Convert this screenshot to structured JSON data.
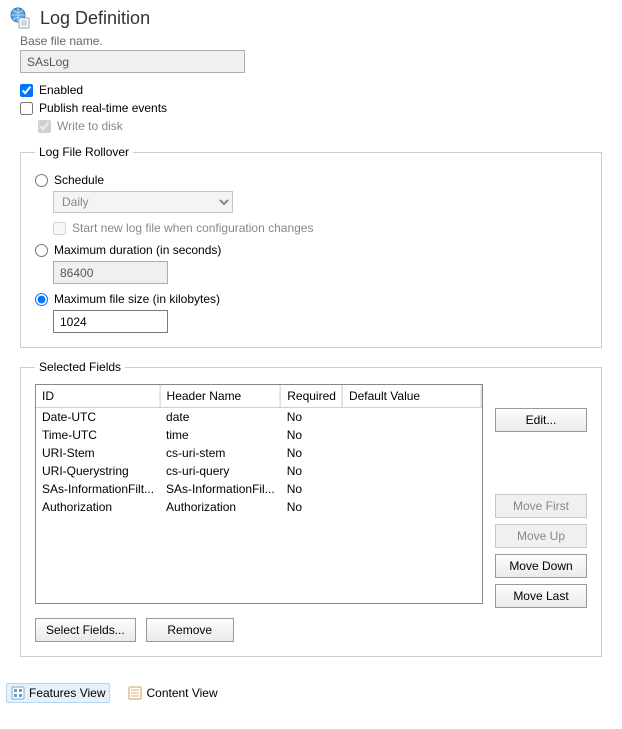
{
  "header": {
    "title": "Log Definition"
  },
  "base_filename_label_cut": "Base file name.",
  "base_filename_value": "SAsLog",
  "enabled": {
    "label": "Enabled",
    "checked": true
  },
  "publish": {
    "label": "Publish real-time events",
    "checked": false
  },
  "write_to_disk": {
    "label": "Write to disk",
    "checked": true
  },
  "rollover": {
    "legend": "Log File Rollover",
    "schedule": {
      "label": "Schedule",
      "checked": false,
      "value": "Daily",
      "start_new_label": "Start new log file when configuration changes",
      "start_new_checked": false
    },
    "duration": {
      "label": "Maximum duration (in seconds)",
      "checked": false,
      "value": "86400"
    },
    "filesize": {
      "label": "Maximum file size (in kilobytes)",
      "checked": true,
      "value": "1024"
    }
  },
  "selected_fields": {
    "legend": "Selected Fields",
    "columns": {
      "id": "ID",
      "header_name": "Header Name",
      "required": "Required",
      "default_value": "Default Value"
    },
    "rows": [
      {
        "id": "Date-UTC",
        "header_name": "date",
        "required": "No",
        "default_value": ""
      },
      {
        "id": "Time-UTC",
        "header_name": "time",
        "required": "No",
        "default_value": ""
      },
      {
        "id": "URI-Stem",
        "header_name": "cs-uri-stem",
        "required": "No",
        "default_value": ""
      },
      {
        "id": "URI-Querystring",
        "header_name": "cs-uri-query",
        "required": "No",
        "default_value": ""
      },
      {
        "id": "SAs-InformationFilt...",
        "header_name": "SAs-InformationFil...",
        "required": "No",
        "default_value": ""
      },
      {
        "id": "Authorization",
        "header_name": "Authorization",
        "required": "No",
        "default_value": ""
      }
    ],
    "buttons": {
      "edit": "Edit...",
      "move_first": "Move First",
      "move_up": "Move Up",
      "move_down": "Move Down",
      "move_last": "Move Last",
      "select_fields": "Select Fields...",
      "remove": "Remove"
    }
  },
  "footer": {
    "features_view": "Features View",
    "content_view": "Content View"
  }
}
